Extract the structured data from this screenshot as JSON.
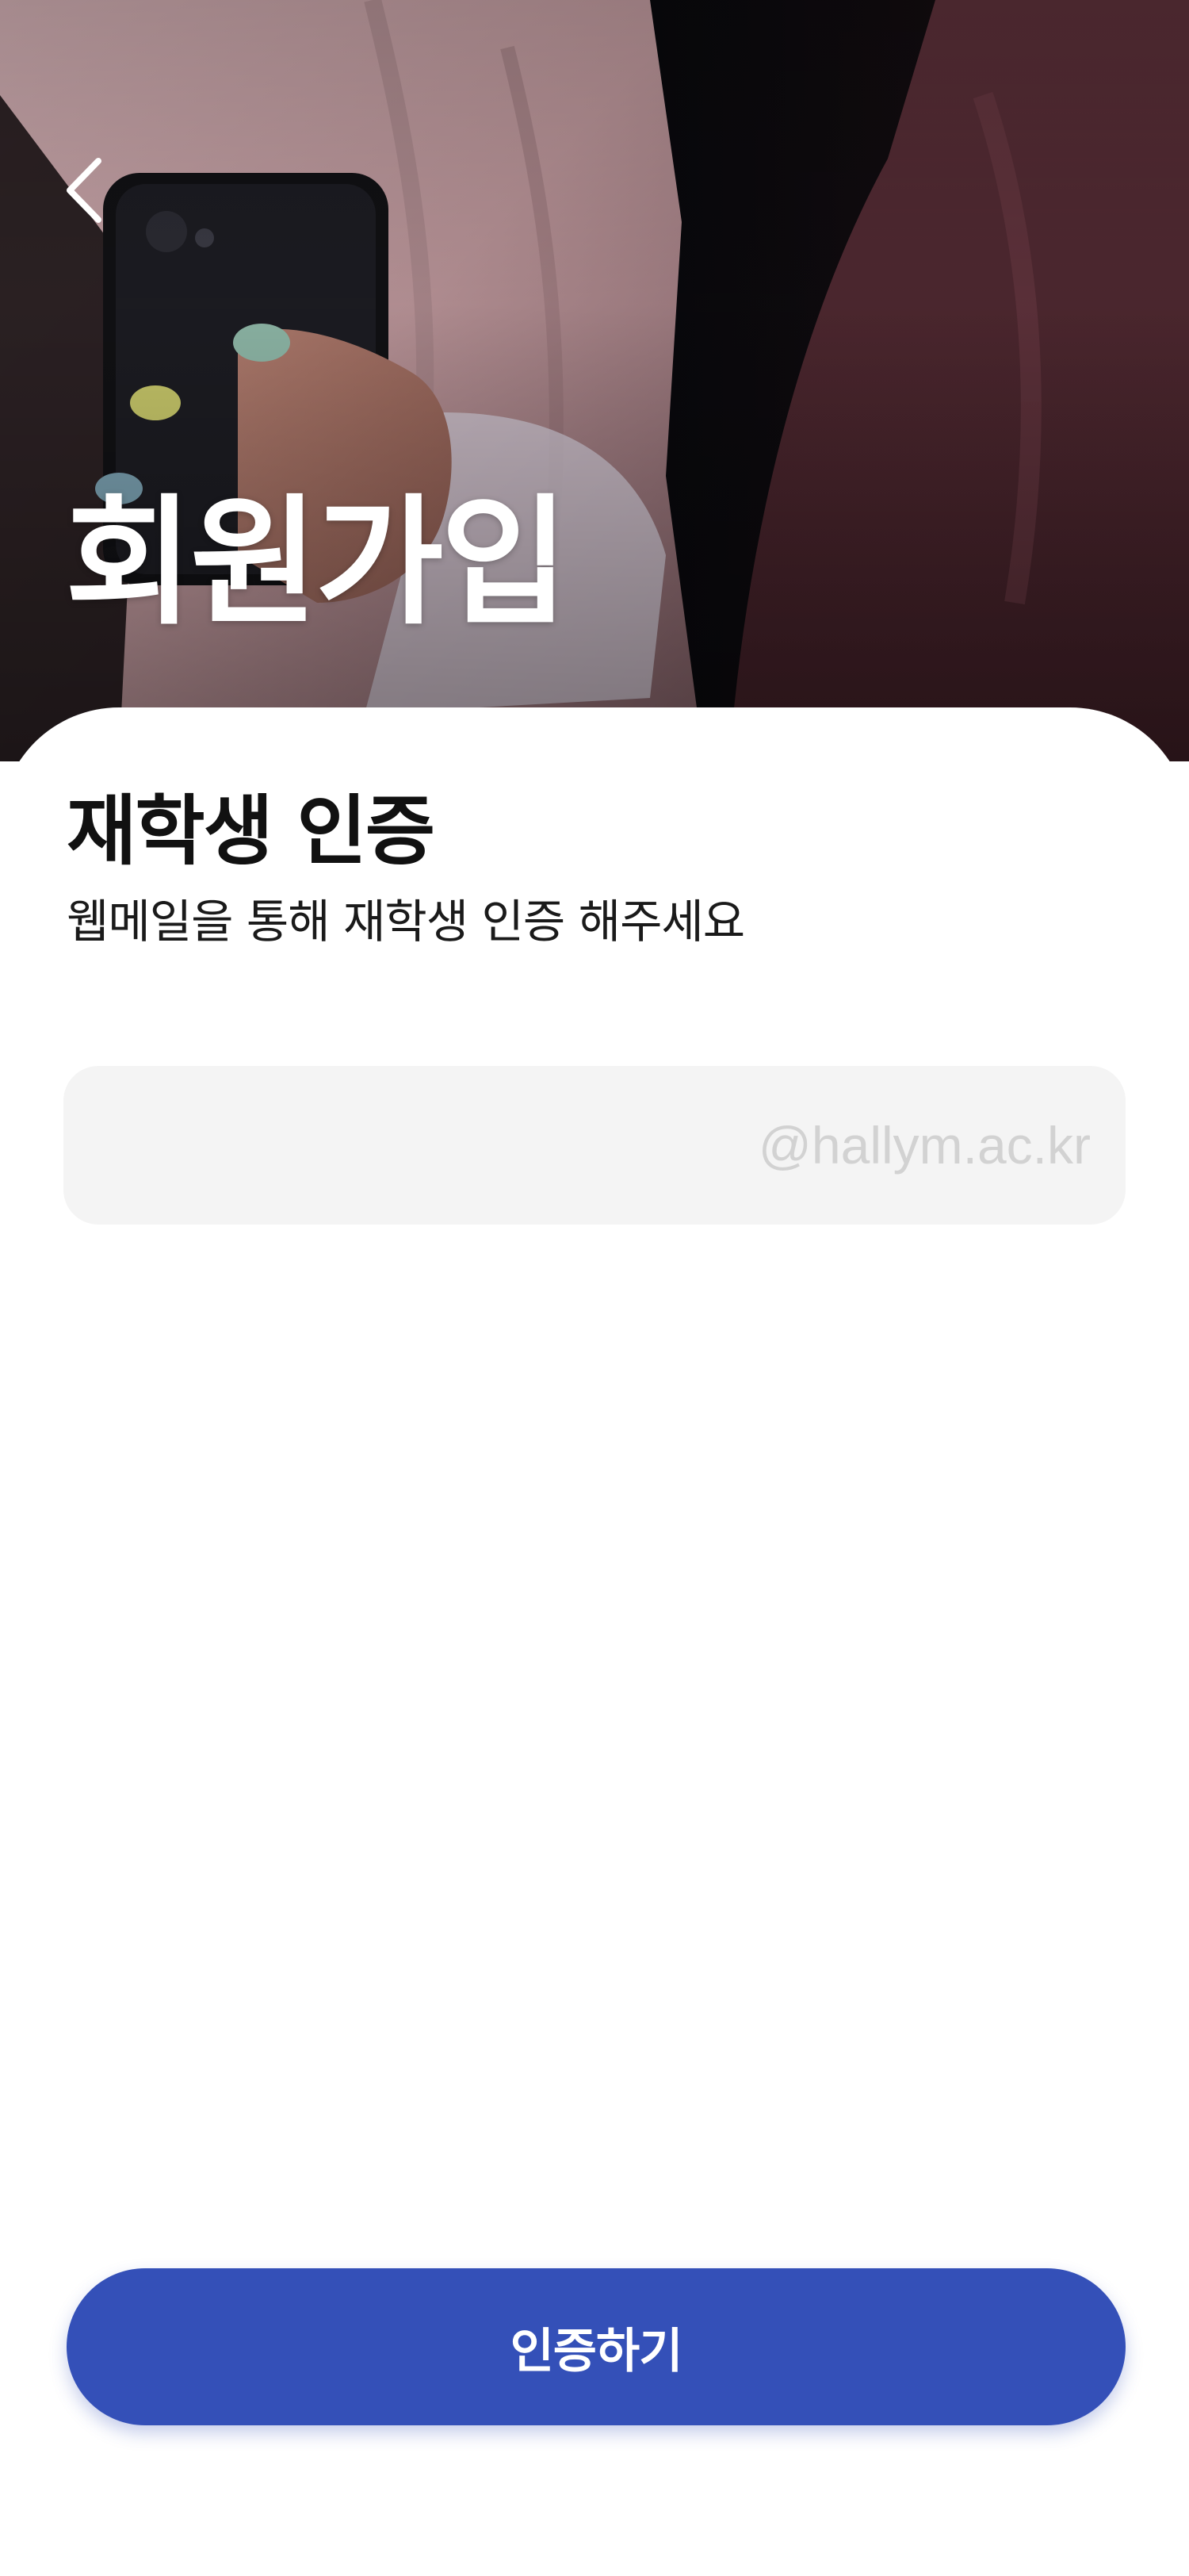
{
  "header": {
    "title": "회원가입",
    "back_icon": "chevron-left-icon"
  },
  "verification": {
    "title": "재학생 인증",
    "subtitle": "웹메일을 통해 재학생 인증 해주세요"
  },
  "email": {
    "value": "",
    "placeholder": "",
    "domain_suffix": "@hallym.ac.kr"
  },
  "actions": {
    "verify_label": "인증하기"
  },
  "colors": {
    "primary": "#3450b8",
    "field_background": "#f4f4f4",
    "suffix_text": "#d2d2d2"
  }
}
